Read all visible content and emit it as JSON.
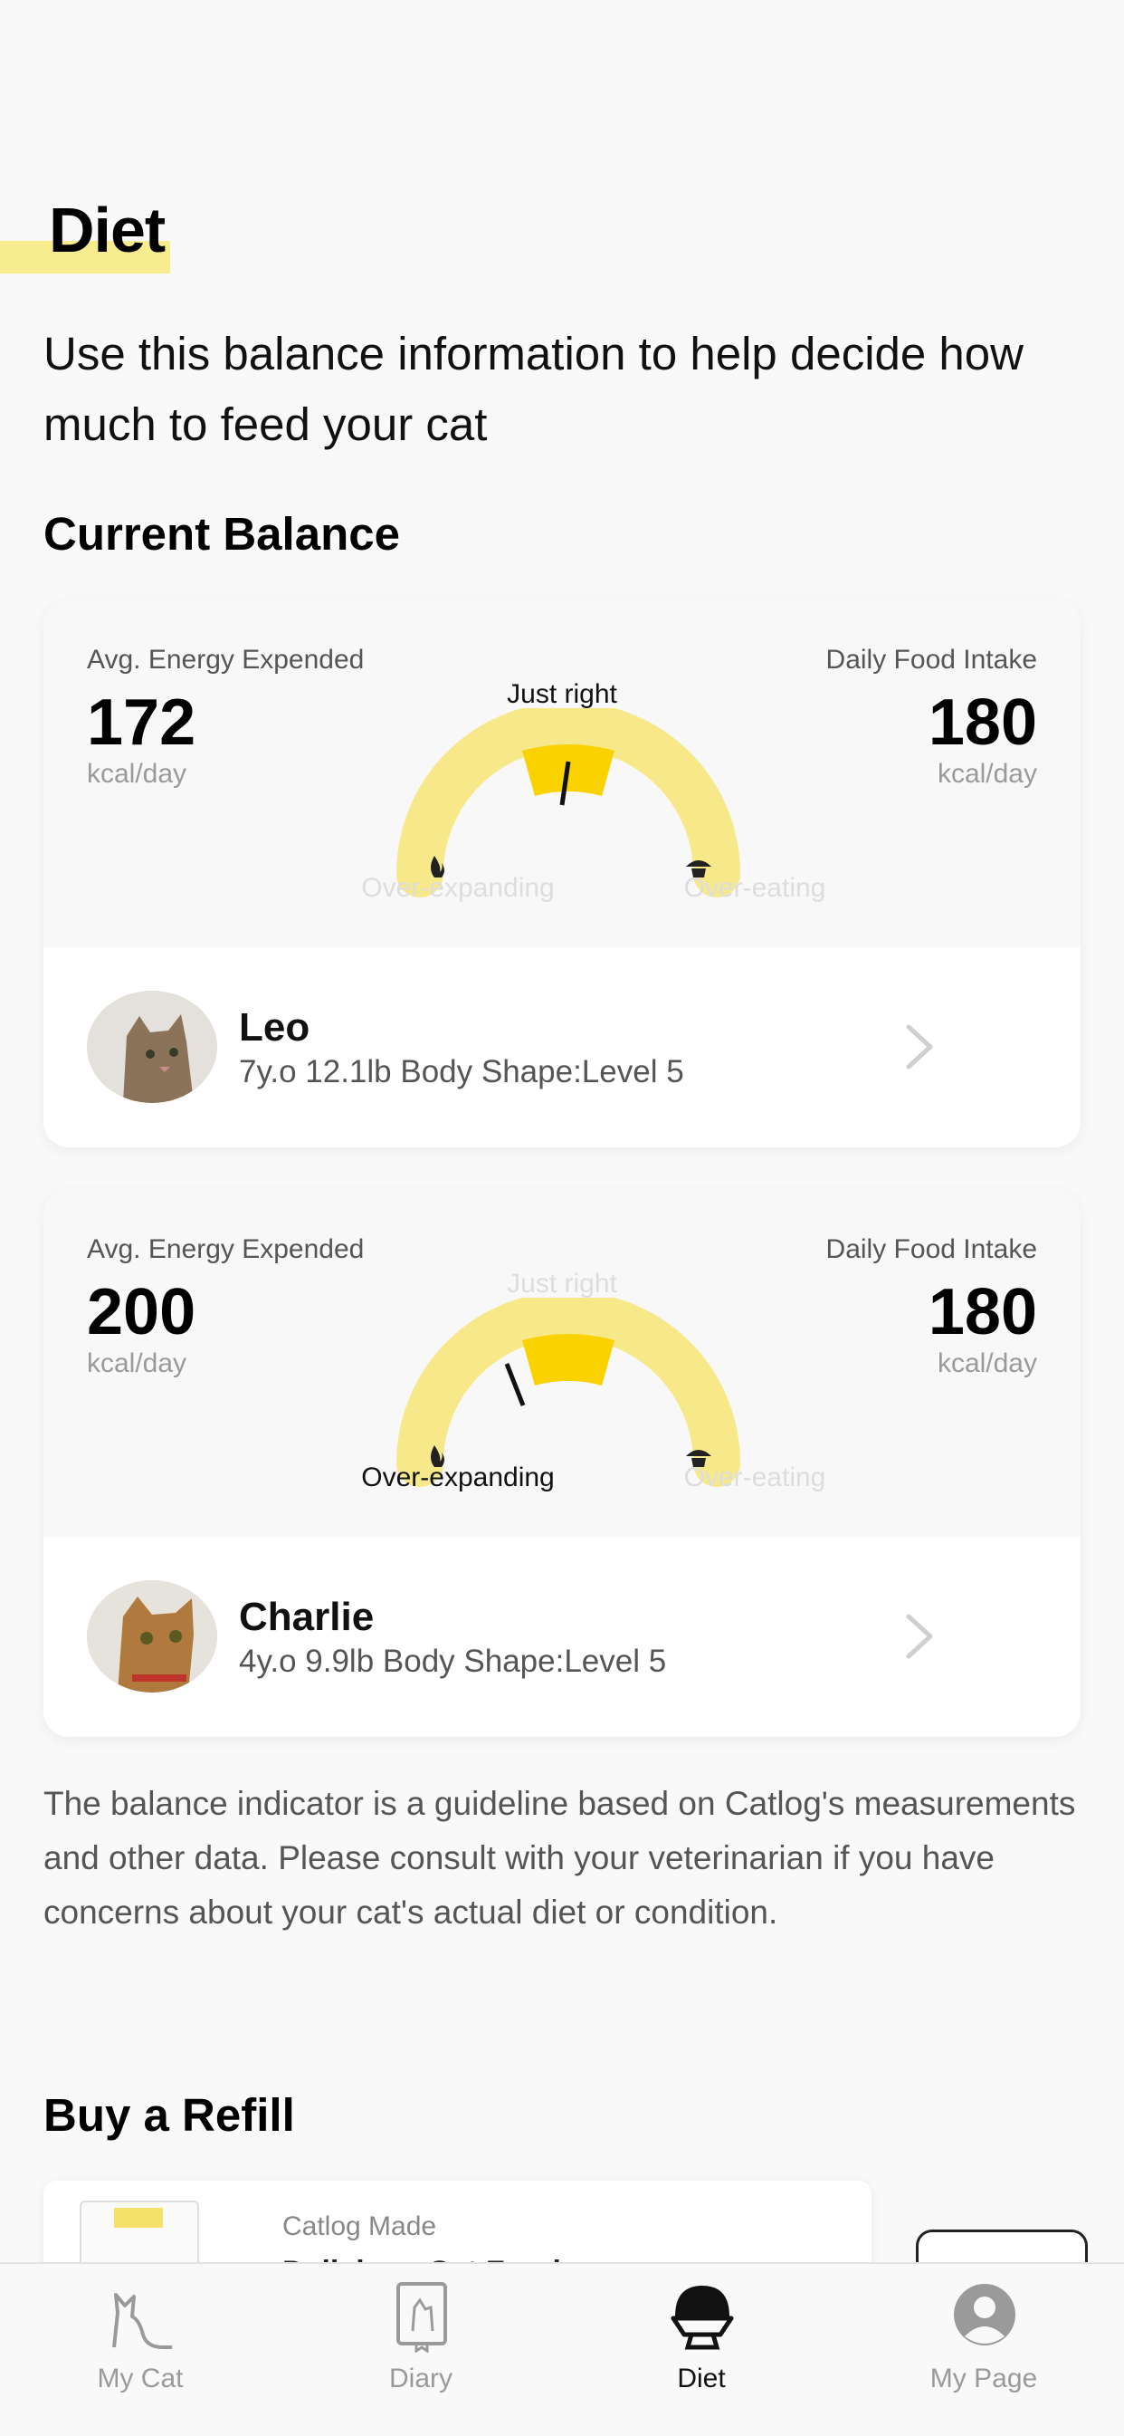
{
  "header": {
    "title": "Diet",
    "intro": "Use this balance information to help decide how much to feed your cat"
  },
  "current_balance": {
    "heading": "Current Balance",
    "labels": {
      "energy": "Avg. Energy Expended",
      "intake": "Daily Food Intake",
      "unit": "kcal/day",
      "just_right": "Just right",
      "over_expanding": "Over-expanding",
      "over_eating": "Over-eating"
    },
    "cards": [
      {
        "energy_value": "172",
        "intake_value": "180",
        "status": "just_right",
        "cat_name": "Leo",
        "cat_info": "7y.o 12.1lb Body Shape:Level 5"
      },
      {
        "energy_value": "200",
        "intake_value": "180",
        "status": "over_expanding",
        "cat_name": "Charlie",
        "cat_info": "4y.o 9.9lb Body Shape:Level 5"
      }
    ]
  },
  "note": "The balance indicator is a guideline based on Catlog's measurements and other data. Please consult with your veterinarian if you have concerns about your cat's actual diet or condition.",
  "refill": {
    "heading": "Buy a Refill",
    "brand": "Catlog Made",
    "product": "Delicious Cat Food"
  },
  "tabbar": {
    "tabs": [
      {
        "label": "My Cat",
        "icon": "cat-icon"
      },
      {
        "label": "Diary",
        "icon": "diary-icon"
      },
      {
        "label": "Diet",
        "icon": "food-bowl-icon",
        "active": true
      },
      {
        "label": "My Page",
        "icon": "person-icon"
      }
    ]
  },
  "colors": {
    "accent_yellow": "#f9d200",
    "gauge_light": "#f7e98a",
    "highlight": "#f7ec8e"
  }
}
